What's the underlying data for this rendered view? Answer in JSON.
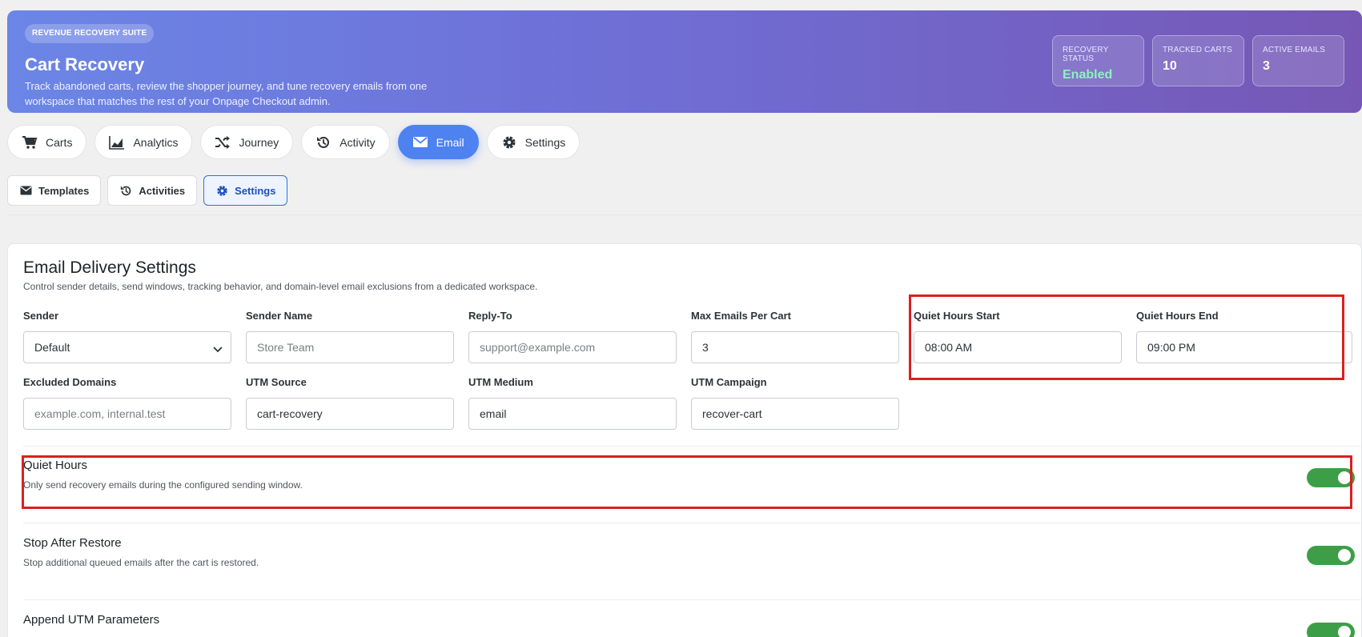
{
  "header": {
    "badge": "REVENUE RECOVERY SUITE",
    "title": "Cart Recovery",
    "description": "Track abandoned carts, review the shopper journey, and tune recovery emails from one workspace that matches the rest of your Onpage Checkout admin.",
    "stats": [
      {
        "label": "RECOVERY STATUS",
        "value": "Enabled"
      },
      {
        "label": "TRACKED CARTS",
        "value": "10"
      },
      {
        "label": "ACTIVE EMAILS",
        "value": "3"
      }
    ]
  },
  "tabs": [
    {
      "label": "Carts",
      "icon": "cart-icon"
    },
    {
      "label": "Analytics",
      "icon": "chart-icon"
    },
    {
      "label": "Journey",
      "icon": "shuffle-icon"
    },
    {
      "label": "Activity",
      "icon": "history-icon"
    },
    {
      "label": "Email",
      "icon": "mail-icon",
      "active": true
    },
    {
      "label": "Settings",
      "icon": "gear-icon"
    }
  ],
  "subtabs": [
    {
      "label": "Templates",
      "icon": "mail-icon"
    },
    {
      "label": "Activities",
      "icon": "history-icon"
    },
    {
      "label": "Settings",
      "icon": "gear-icon",
      "active": true
    }
  ],
  "panel": {
    "title": "Email Delivery Settings",
    "subtitle": "Control sender details, send windows, tracking behavior, and domain-level email exclusions from a dedicated workspace.",
    "fields": {
      "sender": {
        "label": "Sender",
        "value": "Default"
      },
      "sender_name": {
        "label": "Sender Name",
        "placeholder": "Store Team"
      },
      "reply_to": {
        "label": "Reply-To",
        "placeholder": "support@example.com"
      },
      "max_emails": {
        "label": "Max Emails Per Cart",
        "value": "3"
      },
      "quiet_start": {
        "label": "Quiet Hours Start",
        "value": "08:00 AM"
      },
      "quiet_end": {
        "label": "Quiet Hours End",
        "value": "09:00 PM"
      },
      "excluded_domains": {
        "label": "Excluded Domains",
        "placeholder": "example.com, internal.test"
      },
      "utm_source": {
        "label": "UTM Source",
        "value": "cart-recovery"
      },
      "utm_medium": {
        "label": "UTM Medium",
        "value": "email"
      },
      "utm_campaign": {
        "label": "UTM Campaign",
        "value": "recover-cart"
      }
    },
    "toggles": [
      {
        "title": "Quiet Hours",
        "description": "Only send recovery emails during the configured sending window.",
        "on": true
      },
      {
        "title": "Stop After Restore",
        "description": "Stop additional queued emails after the cart is restored.",
        "on": true
      },
      {
        "title": "Append UTM Parameters",
        "description": "",
        "on": true
      }
    ]
  },
  "colors": {
    "accent": "#4d82f0",
    "toggle_on": "#3c9f47",
    "highlight": "#d92020"
  }
}
